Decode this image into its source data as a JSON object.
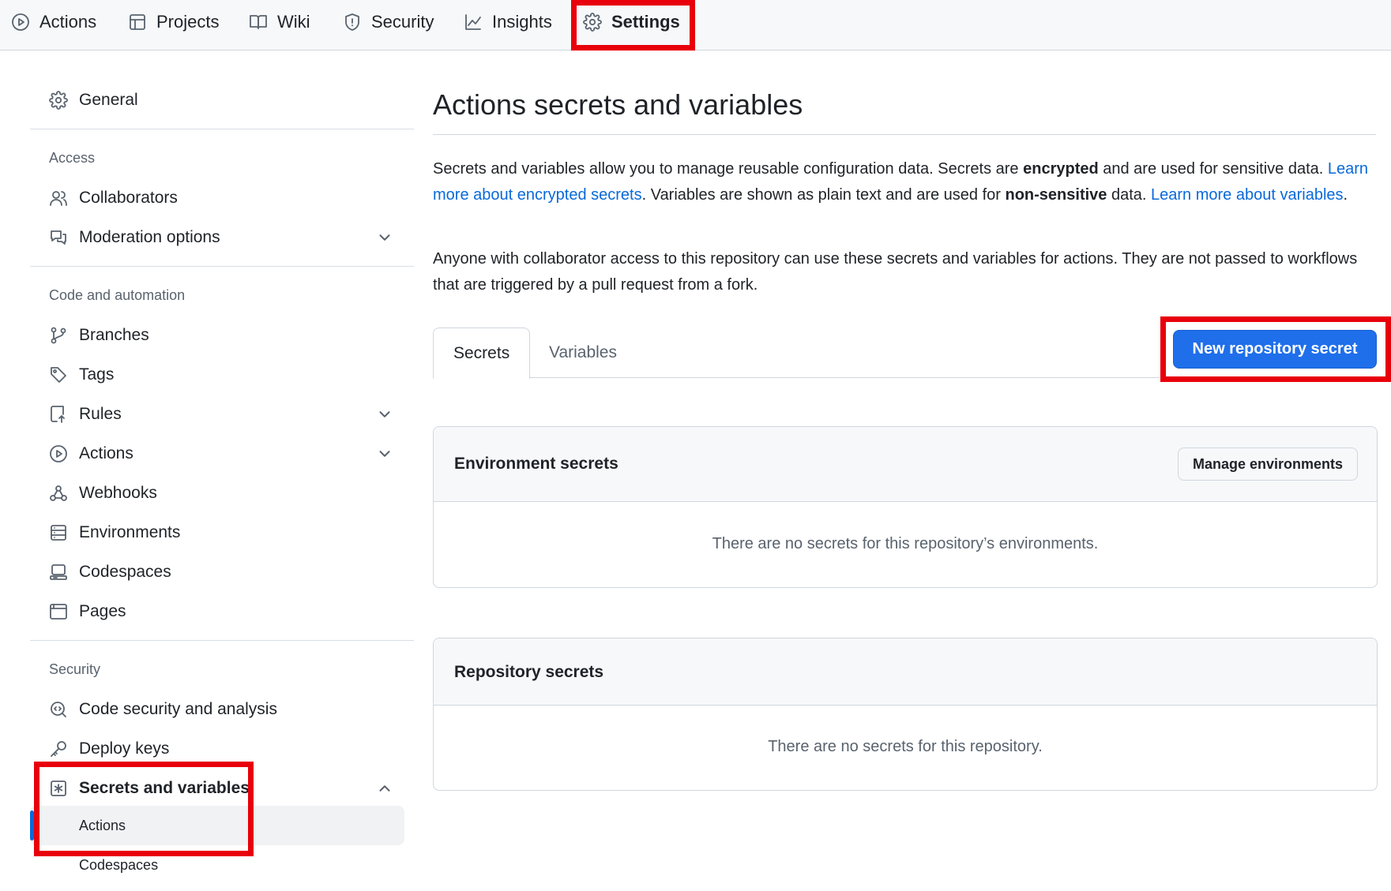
{
  "repo_nav": {
    "tabs": [
      {
        "label": "Actions",
        "icon": "play-circle-icon"
      },
      {
        "label": "Projects",
        "icon": "table-icon"
      },
      {
        "label": "Wiki",
        "icon": "book-icon"
      },
      {
        "label": "Security",
        "icon": "shield-icon"
      },
      {
        "label": "Insights",
        "icon": "graph-icon"
      },
      {
        "label": "Settings",
        "icon": "gear-icon",
        "active": true
      }
    ]
  },
  "sidebar": {
    "general": "General",
    "access_heading": "Access",
    "access_items": [
      "Collaborators",
      "Moderation options"
    ],
    "code_heading": "Code and automation",
    "code_items": [
      "Branches",
      "Tags",
      "Rules",
      "Actions",
      "Webhooks",
      "Environments",
      "Codespaces",
      "Pages"
    ],
    "security_heading": "Security",
    "security_items": [
      "Code security and analysis",
      "Deploy keys",
      "Secrets and variables"
    ],
    "secrets_sub_items": [
      "Actions",
      "Codespaces"
    ],
    "active_sub_item": "Actions"
  },
  "main": {
    "title": "Actions secrets and variables",
    "desc1": {
      "part1": "Secrets and variables allow you to manage reusable configuration data. Secrets are ",
      "bold1": "encrypted",
      "part2": " and are used for sensitive data. ",
      "link1": "Learn more about encrypted secrets",
      "part3": ". Variables are shown as plain text and are used for ",
      "bold2": "non-sensitive",
      "part4": " data. ",
      "link2": "Learn more about variables",
      "part5": "."
    },
    "desc2": "Anyone with collaborator access to this repository can use these secrets and variables for actions. They are not passed to workflows that are triggered by a pull request from a fork.",
    "tabs": [
      "Secrets",
      "Variables"
    ],
    "active_tab": "Secrets",
    "new_secret_button": "New repository secret",
    "environment_secrets": {
      "title": "Environment secrets",
      "manage_button": "Manage environments",
      "empty": "There are no secrets for this repository’s environments."
    },
    "repository_secrets": {
      "title": "Repository secrets",
      "empty": "There are no secrets for this repository."
    }
  },
  "colors": {
    "highlight": "#e8000b",
    "primary": "#1f6feb",
    "link": "#0969da"
  }
}
